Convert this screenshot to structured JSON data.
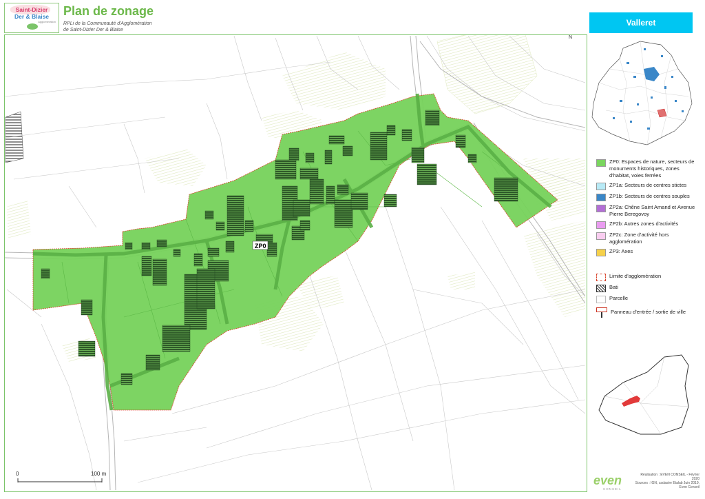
{
  "header": {
    "logo_line1": "Saint-Dizier",
    "logo_line2": "Der & Blaise",
    "logo_line3": "Agglomération",
    "title": "Plan de zonage",
    "subtitle_line1": "RPLi de la Communauté d'Agglomération",
    "subtitle_line2": "de Saint-Dizier Der & Blaise"
  },
  "commune": "Valleret",
  "map": {
    "zone_label": "ZP0",
    "north": "N",
    "scale_start": "0",
    "scale_end": "100 m"
  },
  "legend": {
    "items": [
      {
        "label": "ZP0: Espaces de nature, secteurs de monuments historiques, zones d'habitat, voies ferrées",
        "color": "#7ad55f"
      },
      {
        "label": "ZP1a: Secteurs de centres stictes",
        "color": "#b8eaf6"
      },
      {
        "label": "ZP1b: Secteurs de centres souples",
        "color": "#3a87c8"
      },
      {
        "label": "ZP2a: Chêne Saint Amand et Avenue Pierre Beregovoy",
        "color": "#b36fd6"
      },
      {
        "label": "ZP2b: Autres zones d'activités",
        "color": "#e99cf0"
      },
      {
        "label": "ZP2c: Zone d'activité hors agglomération",
        "color": "#f9cdf0"
      },
      {
        "label": "ZP3: Axes",
        "color": "#f6d14a"
      }
    ],
    "symbols": [
      {
        "label": "Limite d'agglomération",
        "icon": "dashed-red-box"
      },
      {
        "label": "Bati",
        "icon": "hatched-box"
      },
      {
        "label": "Parcelle",
        "icon": "empty-box"
      },
      {
        "label": "Panneau d'entrée / sortie de ville",
        "icon": "red-sign"
      }
    ]
  },
  "footer": {
    "brand": "even",
    "brand_sub": "CONSEIL",
    "credits_line1": "Réalisation : EVEN CONSEIL - Février 2020",
    "credits_line2": "Sources : IGN, cadastre Etalab Juin 2019,",
    "credits_line3": "Even Conseil"
  }
}
